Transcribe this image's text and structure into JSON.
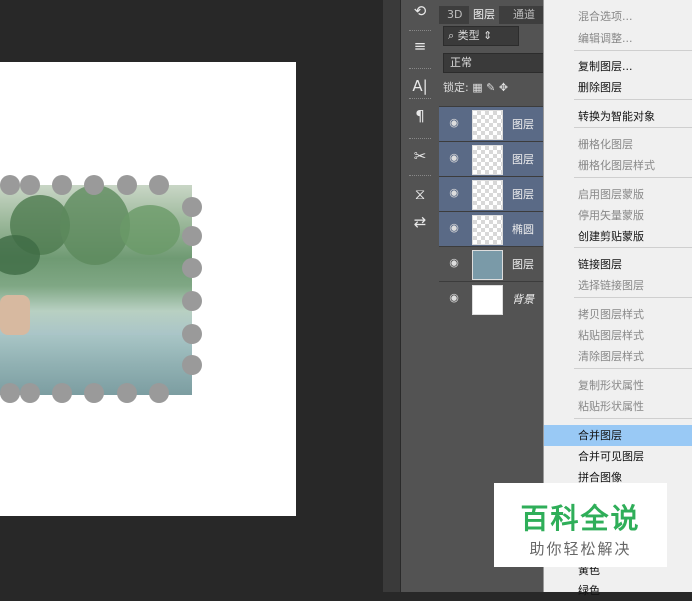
{
  "tools_panel": {
    "icons": [
      "history-icon",
      "brush-preset-icon",
      "character-icon",
      "paragraph-icon",
      "tool-preset-icon",
      "clone-source-icon",
      "properties-icon"
    ],
    "glyphs": [
      "⟲",
      "≡",
      "A|",
      "¶",
      "✂",
      "⧖",
      "⇄"
    ]
  },
  "layers_panel": {
    "tabs": [
      "3D",
      "图层",
      "通道"
    ],
    "filter_label": "类型",
    "blend_mode": "正常",
    "lock_label": "锁定:",
    "layers": [
      {
        "name": "图层",
        "visible": true,
        "thumb": "transparent",
        "selected": true
      },
      {
        "name": "图层",
        "visible": true,
        "thumb": "transparent",
        "selected": true
      },
      {
        "name": "图层",
        "visible": true,
        "thumb": "transparent",
        "selected": true
      },
      {
        "name": "椭圆",
        "visible": true,
        "thumb": "transparent",
        "selected": true
      },
      {
        "name": "图层",
        "visible": true,
        "thumb": "image",
        "selected": false
      },
      {
        "name": "背景",
        "visible": true,
        "thumb": "white",
        "selected": false
      }
    ]
  },
  "context_menu": {
    "items": [
      {
        "label": "混合选项...",
        "disabled": true
      },
      {
        "label": "编辑调整...",
        "disabled": true
      },
      {
        "label": "复制图层...",
        "disabled": false
      },
      {
        "label": "删除图层",
        "disabled": false
      },
      {
        "label": "转换为智能对象",
        "disabled": false
      },
      {
        "label": "栅格化图层",
        "disabled": true
      },
      {
        "label": "栅格化图层样式",
        "disabled": true
      },
      {
        "label": "启用图层蒙版",
        "disabled": true
      },
      {
        "label": "停用矢量蒙版",
        "disabled": true
      },
      {
        "label": "创建剪贴蒙版",
        "disabled": false
      },
      {
        "label": "链接图层",
        "disabled": false
      },
      {
        "label": "选择链接图层",
        "disabled": true
      },
      {
        "label": "拷贝图层样式",
        "disabled": true
      },
      {
        "label": "粘贴图层样式",
        "disabled": true
      },
      {
        "label": "清除图层样式",
        "disabled": true
      },
      {
        "label": "复制形状属性",
        "disabled": true
      },
      {
        "label": "粘贴形状属性",
        "disabled": true
      },
      {
        "label": "合并图层",
        "disabled": false,
        "highlighted": true
      },
      {
        "label": "合并可见图层",
        "disabled": false
      },
      {
        "label": "拼合图像",
        "disabled": false
      },
      {
        "label": "黄色",
        "disabled": false
      },
      {
        "label": "绿色",
        "disabled": false
      }
    ]
  },
  "watermark": {
    "title": "百科全说",
    "subtitle": "助你轻松解决"
  },
  "colors": {
    "selection_blue": "#99c9f5",
    "watermark_green": "#2fae59",
    "selected_layer": "#5a6a86"
  }
}
